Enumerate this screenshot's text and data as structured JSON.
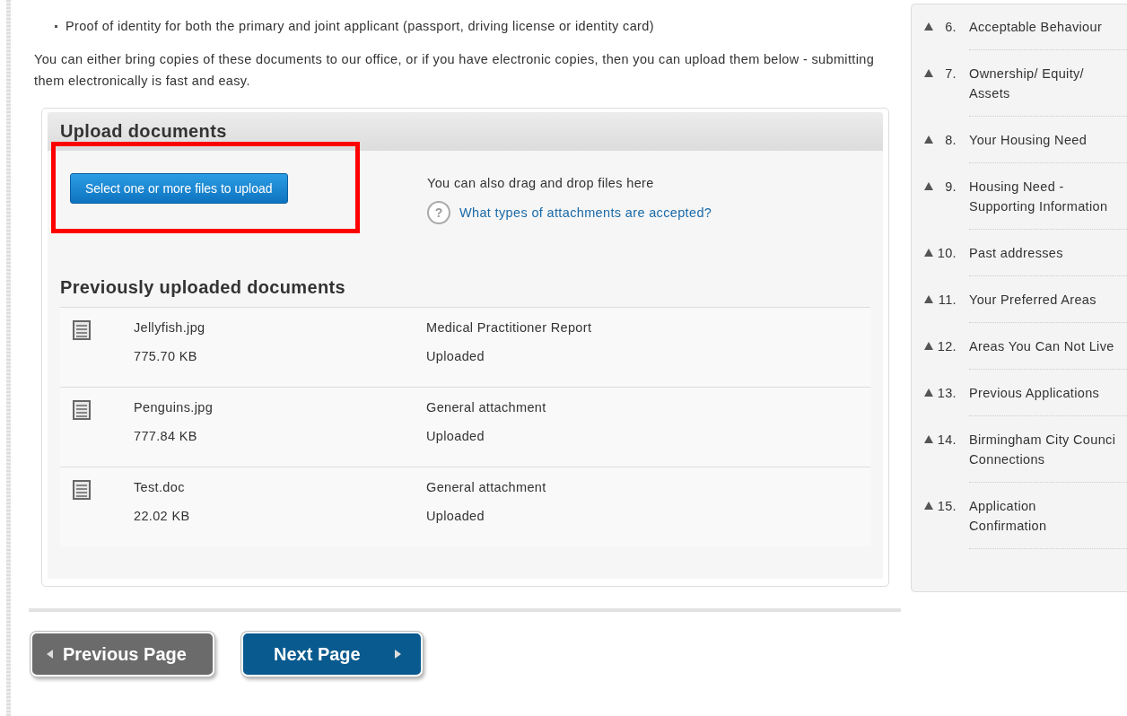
{
  "intro": {
    "bullets": [
      "Proof of identity for both the primary and joint applicant (passport, driving license or identity card)"
    ],
    "paragraph": "You can either bring copies of these documents to our office, or if you have electronic copies, then you can upload them below - submitting them electronically is fast and easy."
  },
  "upload_panel": {
    "title": "Upload documents",
    "select_button": "Select one or more files to upload",
    "drag_hint": "You can also drag and drop files here",
    "help_icon": "?",
    "help_link": "What types of attachments are accepted?",
    "previous_title": "Previously uploaded documents",
    "documents": [
      {
        "name": "Jellyfish.jpg",
        "size": "775.70 KB",
        "category": "Medical Practitioner Report",
        "status": "Uploaded"
      },
      {
        "name": "Penguins.jpg",
        "size": "777.84 KB",
        "category": "General attachment",
        "status": "Uploaded"
      },
      {
        "name": "Test.doc",
        "size": "22.02 KB",
        "category": "General attachment",
        "status": "Uploaded"
      }
    ]
  },
  "navigation": {
    "previous": "Previous Page",
    "next": "Next Page"
  },
  "sidebar": {
    "items": [
      {
        "number": "6.",
        "label": "Acceptable Behaviour"
      },
      {
        "number": "7.",
        "label": "Ownership/ Equity/ Assets"
      },
      {
        "number": "8.",
        "label": "Your Housing Need"
      },
      {
        "number": "9.",
        "label": "Housing Need - Supporting Information"
      },
      {
        "number": "10.",
        "label": "Past addresses"
      },
      {
        "number": "11.",
        "label": "Your Preferred Areas"
      },
      {
        "number": "12.",
        "label": "Areas You Can Not Live"
      },
      {
        "number": "13.",
        "label": "Previous Applications"
      },
      {
        "number": "14.",
        "label": "Birmingham City Counci Connections"
      },
      {
        "number": "15.",
        "label": "Application Confirmation"
      }
    ]
  }
}
